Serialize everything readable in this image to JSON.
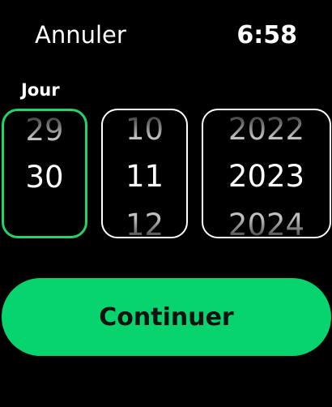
{
  "header": {
    "cancel_label": "Annuler",
    "time": "6:58"
  },
  "picker": {
    "field_label": "Jour",
    "day": {
      "previous": "29",
      "selected": "30",
      "next": ""
    },
    "month": {
      "previous": "10",
      "selected": "11",
      "next": "12"
    },
    "year": {
      "previous": "2022",
      "selected": "2023",
      "next": "2024"
    }
  },
  "actions": {
    "continue_label": "Continuer"
  },
  "colors": {
    "accent": "#07d46e",
    "active_border": "#21d36a"
  }
}
